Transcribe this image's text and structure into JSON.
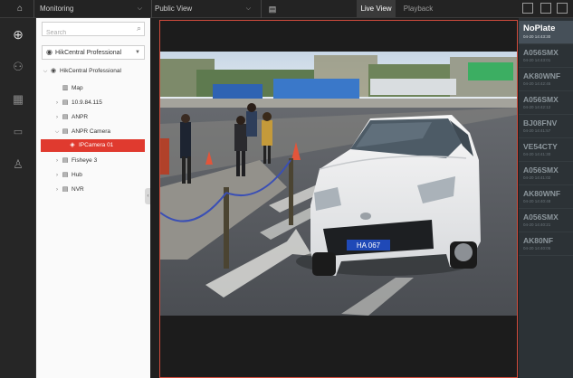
{
  "topbar": {
    "module": "Monitoring",
    "view": "Public View",
    "tabs": [
      "Live View",
      "Playback"
    ]
  },
  "tree": {
    "search_placeholder": "Search",
    "site_select": "HikCentral Professional",
    "nodes": [
      {
        "label": "HikCentral Professional",
        "icon": "globe-icon",
        "expand": "v"
      },
      {
        "label": "Map",
        "icon": "map-icon",
        "expand": ""
      },
      {
        "label": "10.9.84.115",
        "icon": "device-icon",
        "expand": ">"
      },
      {
        "label": "ANPR",
        "icon": "device-icon",
        "expand": ">"
      },
      {
        "label": "ANPR Camera",
        "icon": "device-icon",
        "expand": "v"
      },
      {
        "label": "IPCamera 01",
        "icon": "camera-icon",
        "expand": ""
      },
      {
        "label": "Fisheye 3",
        "icon": "device-icon",
        "expand": ">"
      },
      {
        "label": "Hub",
        "icon": "device-icon",
        "expand": ">"
      },
      {
        "label": "NVR",
        "icon": "device-icon",
        "expand": ">"
      }
    ]
  },
  "plates": [
    {
      "plate": "NoPlate",
      "time": "04-20 14:43:30"
    },
    {
      "plate": "A056SMX",
      "time": "04-20 14:43:01"
    },
    {
      "plate": "AK80WNF",
      "time": "04-20 14:42:45"
    },
    {
      "plate": "A056SMX",
      "time": "04-20 14:42:12"
    },
    {
      "plate": "BJ08FNV",
      "time": "04-20 14:41:57"
    },
    {
      "plate": "VE54CTY",
      "time": "04-20 14:41:30"
    },
    {
      "plate": "A056SMX",
      "time": "04-20 14:41:02"
    },
    {
      "plate": "AK80WNF",
      "time": "04-20 14:40:48"
    },
    {
      "plate": "A056SMX",
      "time": "04-20 14:40:21"
    },
    {
      "plate": "AK80NF",
      "time": "04-20 14:40:05"
    }
  ],
  "video": {
    "car_plate": "HA 067"
  }
}
